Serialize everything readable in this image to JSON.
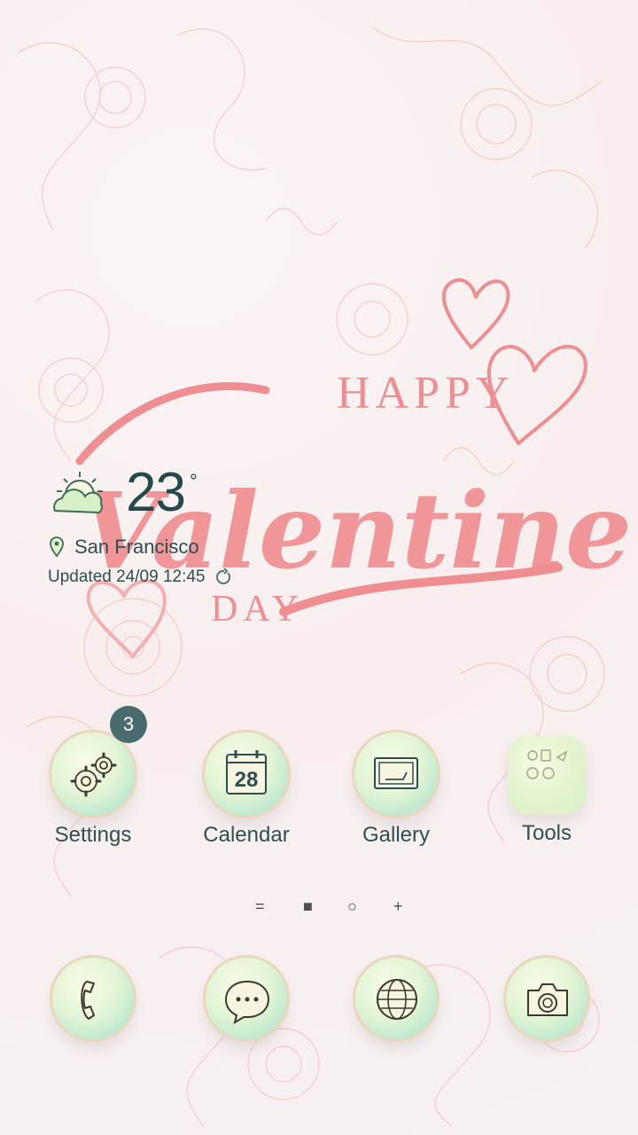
{
  "weather": {
    "temperature": "23",
    "degree_symbol": "°",
    "icon": "partly-cloudy-icon",
    "location": "San Francisco",
    "updated": "Updated 24/09 12:45"
  },
  "apps": [
    {
      "label": "Settings",
      "icon": "gears-icon",
      "badge": "3"
    },
    {
      "label": "Calendar",
      "icon": "calendar-icon",
      "date": "28"
    },
    {
      "label": "Gallery",
      "icon": "gallery-icon"
    },
    {
      "label": "Tools",
      "icon": "tools-folder-icon"
    }
  ],
  "dock": [
    {
      "icon": "phone-icon"
    },
    {
      "icon": "messages-icon"
    },
    {
      "icon": "browser-globe-icon"
    },
    {
      "icon": "camera-icon"
    }
  ],
  "wallpaper_text": {
    "happy": "HAPPY",
    "valentines": "Valentine's",
    "day": "DAY"
  },
  "colors": {
    "text": "#2f4f51",
    "wallpaper_pink": "#ee8e90",
    "badge": "#4a6b6b"
  }
}
